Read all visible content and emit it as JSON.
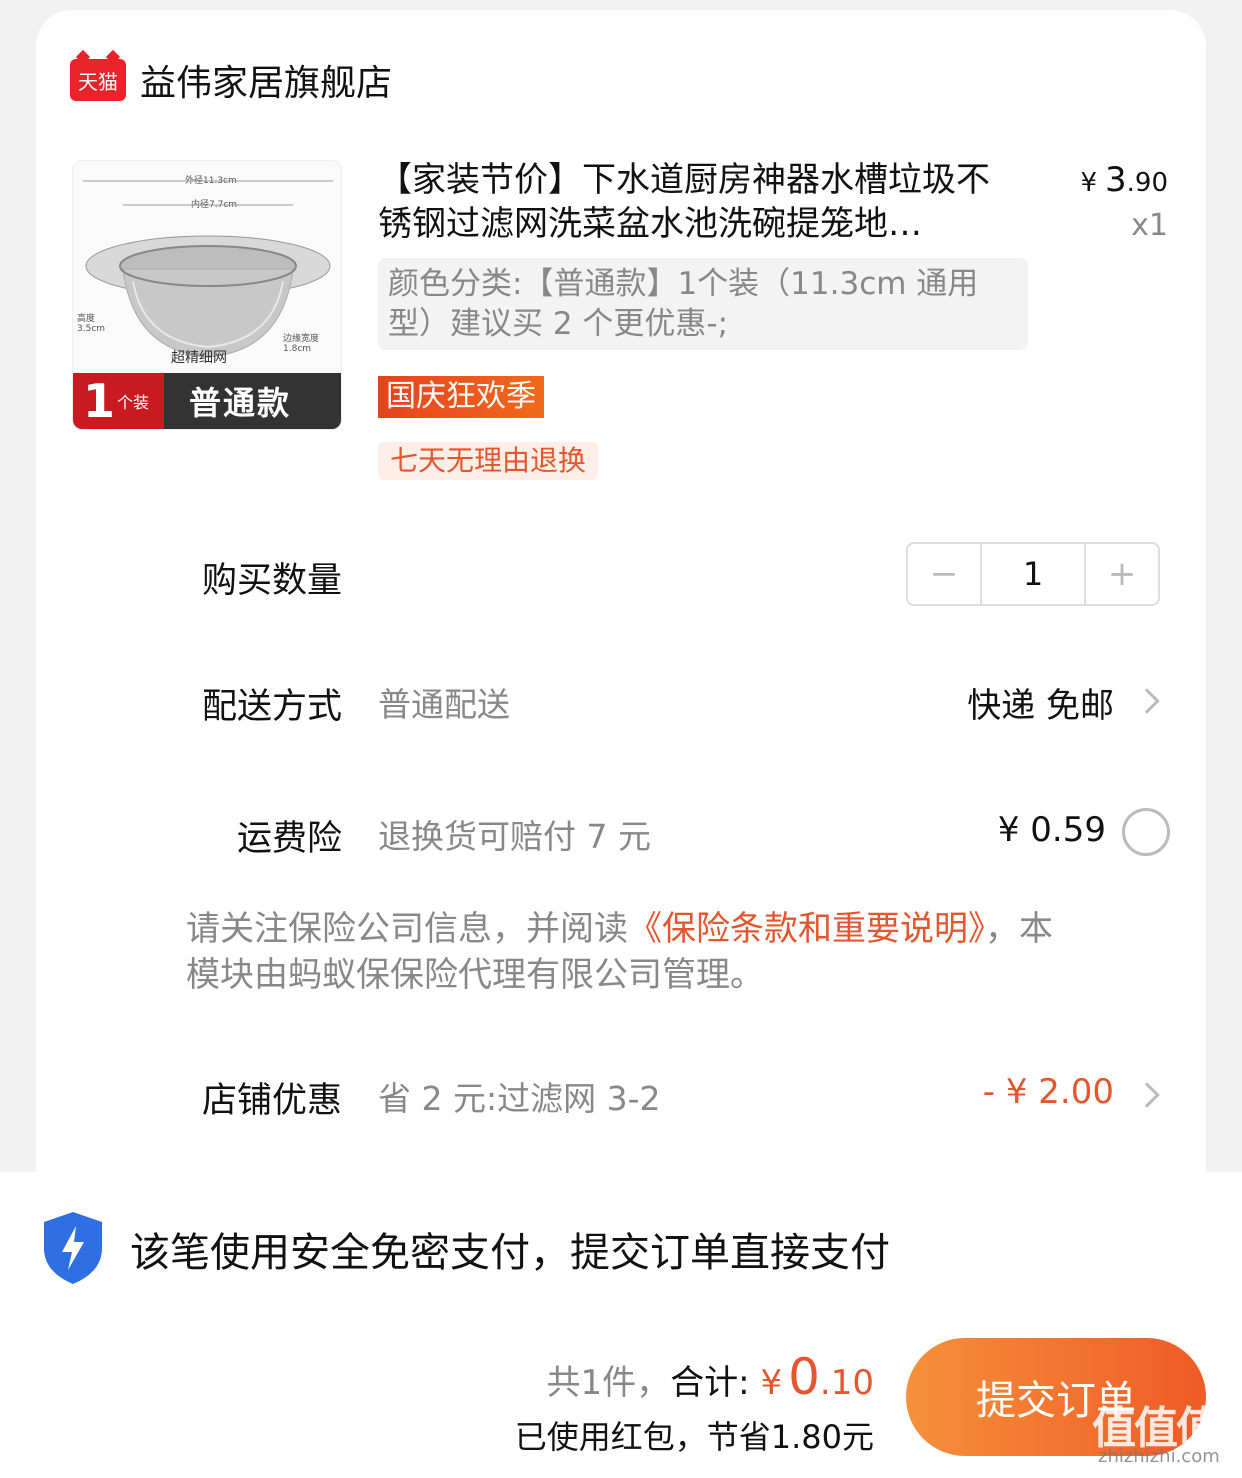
{
  "store": {
    "logo_text": "天猫",
    "name": "益伟家居旗舰店"
  },
  "product": {
    "image_dims": {
      "outer": "外径11.3cm",
      "inner": "内径7.7cm",
      "height": "高度3.5cm",
      "edge": "边缘宽度1.8cm"
    },
    "image_mesh_label": "超精细网",
    "image_banner_num": "1",
    "image_banner_unit": "个装",
    "image_banner_kind": "普通款",
    "title": "【家装节价】下水道厨房神器水槽垃圾不锈钢过滤网洗菜盆水池洗碗提笼地…",
    "price_symbol": "¥",
    "price_int": "3",
    "price_dec": ".90",
    "quantity_label": "x1",
    "spec": "颜色分类:【普通款】1个装（11.3cm 通用型）建议买 2 个更优惠-;",
    "promo_tag": "国庆狂欢季",
    "return_tag": "七天无理由退换"
  },
  "quantity": {
    "label": "购买数量",
    "minus": "−",
    "value": "1",
    "plus": "+"
  },
  "delivery": {
    "label": "配送方式",
    "method": "普通配送",
    "value": "快递 免邮"
  },
  "insurance": {
    "label": "运费险",
    "desc": "退换货可赔付 7 元",
    "price": "¥ 0.59",
    "notice_prefix": "请关注保险公司信息，并阅读",
    "notice_link": "《保险条款和重要说明》",
    "notice_suffix": "，本模块由蚂蚁保保险代理有限公司管理。"
  },
  "shop_discount": {
    "label": "店铺优惠",
    "desc": "省 2 元:过滤网 3-2",
    "value": "- ¥ 2.00"
  },
  "payment": {
    "secure_text": "该笔使用安全免密支付，提交订单直接支付",
    "count_text": "共1件，",
    "total_label": "合计:",
    "total_symbol": "¥",
    "total_int": "0",
    "total_dec": ".10",
    "saved_text": "已使用红包，节省1.80元",
    "submit_label": "提交订单"
  },
  "watermark": {
    "logo": "值值值",
    "site": "zhizhizhi.com"
  },
  "colors": {
    "accent": "#e4572e",
    "tmall_red": "#e8232a",
    "shield_blue": "#2f6fe4"
  }
}
